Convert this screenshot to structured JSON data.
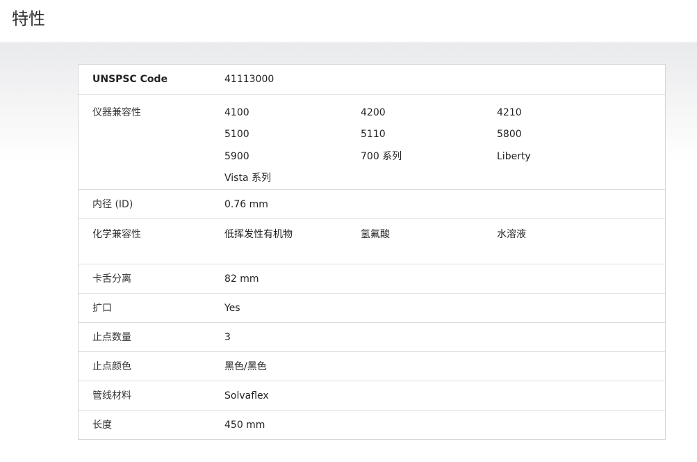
{
  "header": {
    "title": "特性"
  },
  "specs": {
    "unspsc": {
      "label": "UNSPSC Code",
      "value": "41113000"
    },
    "instrument_compat": {
      "label": "仪器兼容性",
      "values": [
        "4100",
        "4200",
        "4210",
        "5100",
        "5110",
        "5800",
        "5900",
        "700 系列",
        "Liberty",
        "Vista 系列"
      ]
    },
    "inner_diameter": {
      "label": "内径 (ID)",
      "value": "0.76 mm"
    },
    "chemical_compat": {
      "label": "化学兼容性",
      "values": [
        "低挥发性有机物",
        "氢氟酸",
        "水溶液"
      ]
    },
    "tab_separation": {
      "label": "卡舌分离",
      "value": "82 mm"
    },
    "flared": {
      "label": "扩口",
      "value": "Yes"
    },
    "stop_count": {
      "label": "止点数量",
      "value": "3"
    },
    "stop_color": {
      "label": "止点颜色",
      "value": "黑色/黑色"
    },
    "tubing_material": {
      "label": "管线材料",
      "value": "Solvaflex"
    },
    "length": {
      "label": "长度",
      "value": "450 mm"
    }
  }
}
